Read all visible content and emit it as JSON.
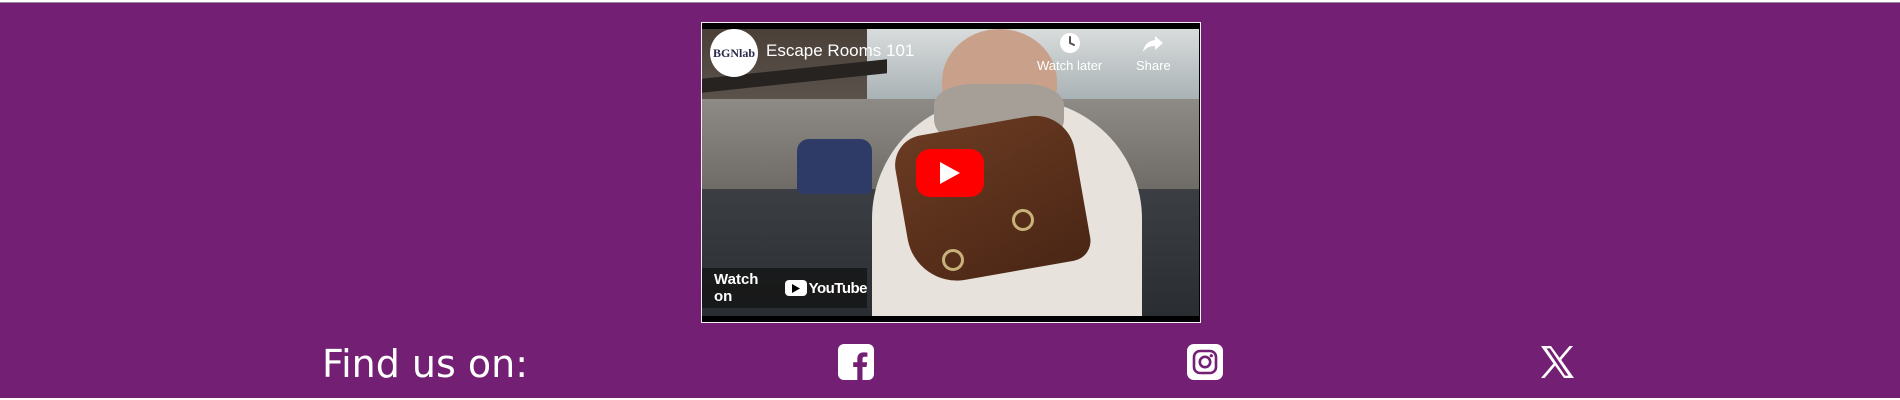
{
  "video": {
    "channel_logo_text": "BGNlab",
    "title": "Escape Rooms 101",
    "watch_later_label": "Watch later",
    "share_label": "Share",
    "watch_on_label": "Watch on",
    "youtube_wordmark": "YouTube",
    "play_button_color": "#ff0000"
  },
  "social": {
    "heading": "Find us on:",
    "icons": [
      "facebook-icon",
      "instagram-icon",
      "x-icon"
    ]
  },
  "colors": {
    "band_background": "#732074",
    "text": "#ffffff"
  }
}
